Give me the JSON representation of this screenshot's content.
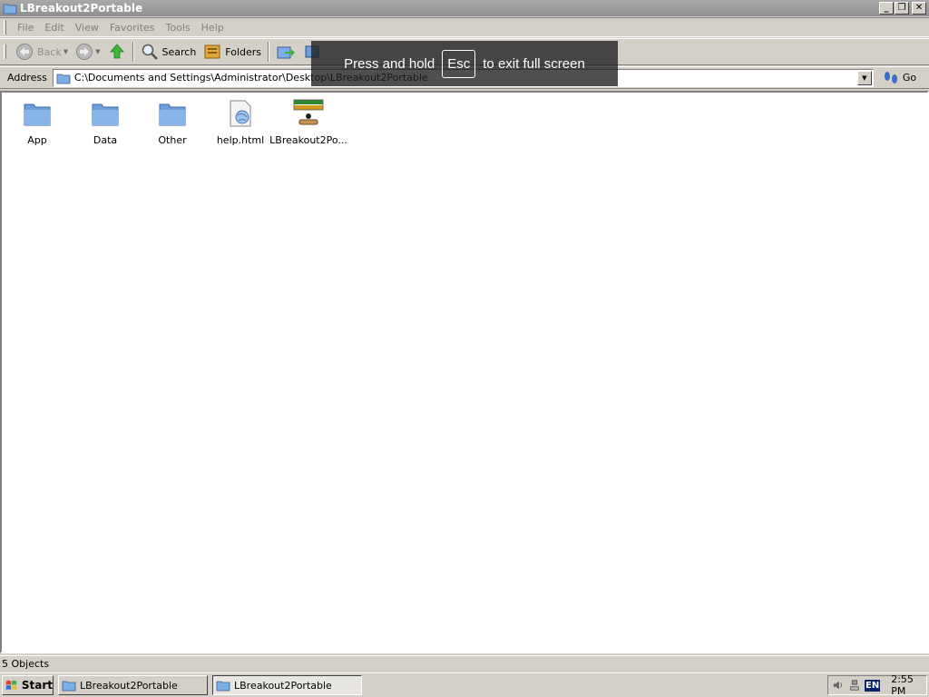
{
  "window": {
    "title": "LBreakout2Portable",
    "controls": {
      "minimize": "_",
      "restore": "❐",
      "close": "✕"
    }
  },
  "menu": [
    "File",
    "Edit",
    "View",
    "Favorites",
    "Tools",
    "Help"
  ],
  "toolbar": {
    "back_label": "Back",
    "search_label": "Search",
    "folders_label": "Folders"
  },
  "address": {
    "label": "Address",
    "path": "C:\\Documents and Settings\\Administrator\\Desktop\\LBreakout2Portable",
    "go_label": "Go"
  },
  "fullscreen_notice": {
    "prefix": "Press and hold",
    "key": "Esc",
    "suffix": "to exit full screen"
  },
  "files": [
    {
      "name": "App",
      "icon": "folder-icon"
    },
    {
      "name": "Data",
      "icon": "folder-icon"
    },
    {
      "name": "Other",
      "icon": "folder-icon"
    },
    {
      "name": "help.html",
      "icon": "html-file-icon"
    },
    {
      "name": "LBreakout2Po...",
      "icon": "lbreakout-app-icon"
    }
  ],
  "status": {
    "text": "5 Objects"
  },
  "taskbar": {
    "start_label": "Start",
    "tasks": [
      "LBreakout2Portable",
      "LBreakout2Portable"
    ],
    "lang": "EN",
    "clock": "2:55 PM"
  },
  "colors": {
    "folder": "#6f9fd8",
    "titlebar": "#9a9a9a",
    "green_arrow": "#2fa82f"
  }
}
